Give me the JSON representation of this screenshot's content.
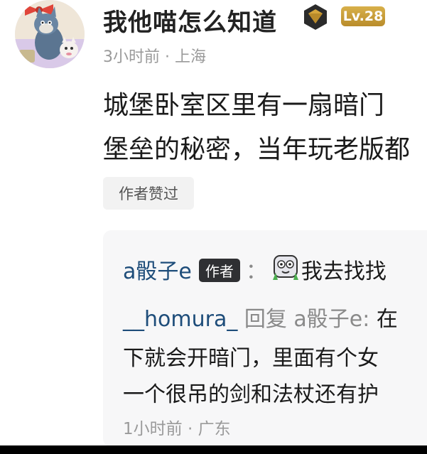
{
  "post": {
    "username": "我他喵怎么知道",
    "badge_icon": "gold-gem-icon",
    "level": "Lv.28",
    "time": "3小时前",
    "separator": "·",
    "location": "上海",
    "content_line1": "城堡卧室区里有一扇暗门",
    "content_line2": "堡垒的秘密，当年玩老版都",
    "author_liked": "作者赞过"
  },
  "reply_thread": {
    "reply1_name": "a骰子e",
    "reply1_author_tag": "作者",
    "reply1_colon": "：",
    "reply1_sticker": "sticker-face-icon",
    "reply1_text": "我去找找",
    "reply2_name": "__homura_",
    "reply2_reply_word": "回复",
    "reply2_target": "a骰子e:",
    "reply2_text_start": "在",
    "reply2_line2": "下就会开暗门，里面有个女",
    "reply2_line3": "一个很吊的剑和法杖还有护",
    "reply2_time": "1小时前",
    "reply2_separator": "·",
    "reply2_location": "广东"
  }
}
